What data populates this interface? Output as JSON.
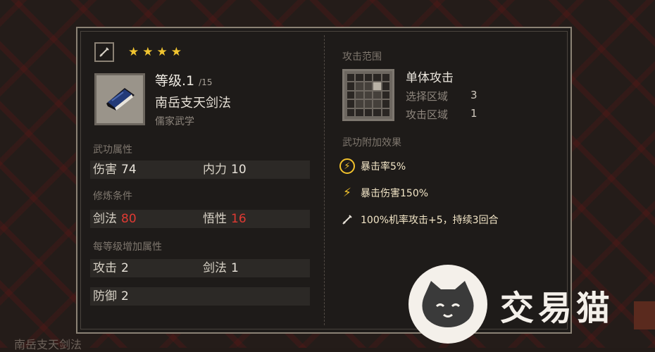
{
  "background": {
    "footer_text": "南岳支天剑法"
  },
  "card": {
    "type_icon": "sword-icon",
    "stars": [
      "★",
      "★",
      "★",
      "★"
    ],
    "level_label": "等级.1",
    "level_max": "/15",
    "skill_name": "南岳支天剑法",
    "school": "儒家武学",
    "book_icon": "book-icon"
  },
  "attributes": {
    "label": "武功属性",
    "items": [
      {
        "name": "伤害",
        "value": "74"
      },
      {
        "name": "内力",
        "value": "10"
      }
    ]
  },
  "requirements": {
    "label": "修炼条件",
    "items": [
      {
        "name": "剑法",
        "value": "80"
      },
      {
        "name": "悟性",
        "value": "16"
      }
    ]
  },
  "per_level": {
    "label": "每等级增加属性",
    "items": [
      {
        "name": "攻击",
        "value": "2"
      },
      {
        "name": "剑法",
        "value": "1"
      },
      {
        "name": "防御",
        "value": "2"
      }
    ]
  },
  "range": {
    "label": "攻击范围",
    "type": "单体攻击",
    "select_label": "选择区域",
    "select_value": "3",
    "attack_label": "攻击区域",
    "attack_value": "1"
  },
  "effects": {
    "label": "武功附加效果",
    "items": [
      {
        "icon": "lightning-ring-icon",
        "text": "暴击率5%"
      },
      {
        "icon": "lightning-icon",
        "text": "暴击伤害150%"
      },
      {
        "icon": "sword-icon",
        "text": "100%机率攻击+5，持续3回合"
      }
    ]
  },
  "watermark": {
    "text": "交易猫"
  },
  "colors": {
    "star": "#f0c430",
    "requirement_value": "#e03a33",
    "effect_icon": "#f2c22c"
  }
}
